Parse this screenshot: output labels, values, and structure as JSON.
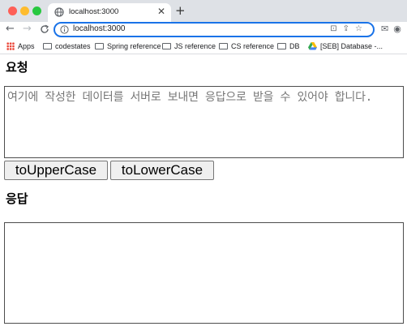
{
  "browser": {
    "tab_title": "localhost:3000",
    "tab_close": "✕",
    "new_tab": "+",
    "url": "localhost:3000",
    "nav": {
      "back": "←",
      "forward": "→",
      "reload": "C"
    }
  },
  "bookmarks": [
    {
      "label": "Apps",
      "icon": "apps-grid-icon"
    },
    {
      "label": "codestates",
      "icon": "folder-icon"
    },
    {
      "label": "Spring reference",
      "icon": "folder-icon"
    },
    {
      "label": "JS reference",
      "icon": "folder-icon"
    },
    {
      "label": "CS reference",
      "icon": "folder-icon"
    },
    {
      "label": "DB",
      "icon": "folder-icon"
    },
    {
      "label": "[SEB] Database -...",
      "icon": "drive-icon"
    }
  ],
  "page": {
    "request_heading": "요청",
    "request_placeholder": "여기에 작성한 데이터를 서버로 보내면 응답으로 받을 수 있어야 합니다.",
    "upper_button": "toUpperCase",
    "lower_button": "toLowerCase",
    "response_heading": "응답",
    "response_value": ""
  },
  "colors": {
    "tabstrip": "#dee1e6",
    "omnibox_focus": "#1a73e8",
    "button_bg": "#efefef"
  }
}
